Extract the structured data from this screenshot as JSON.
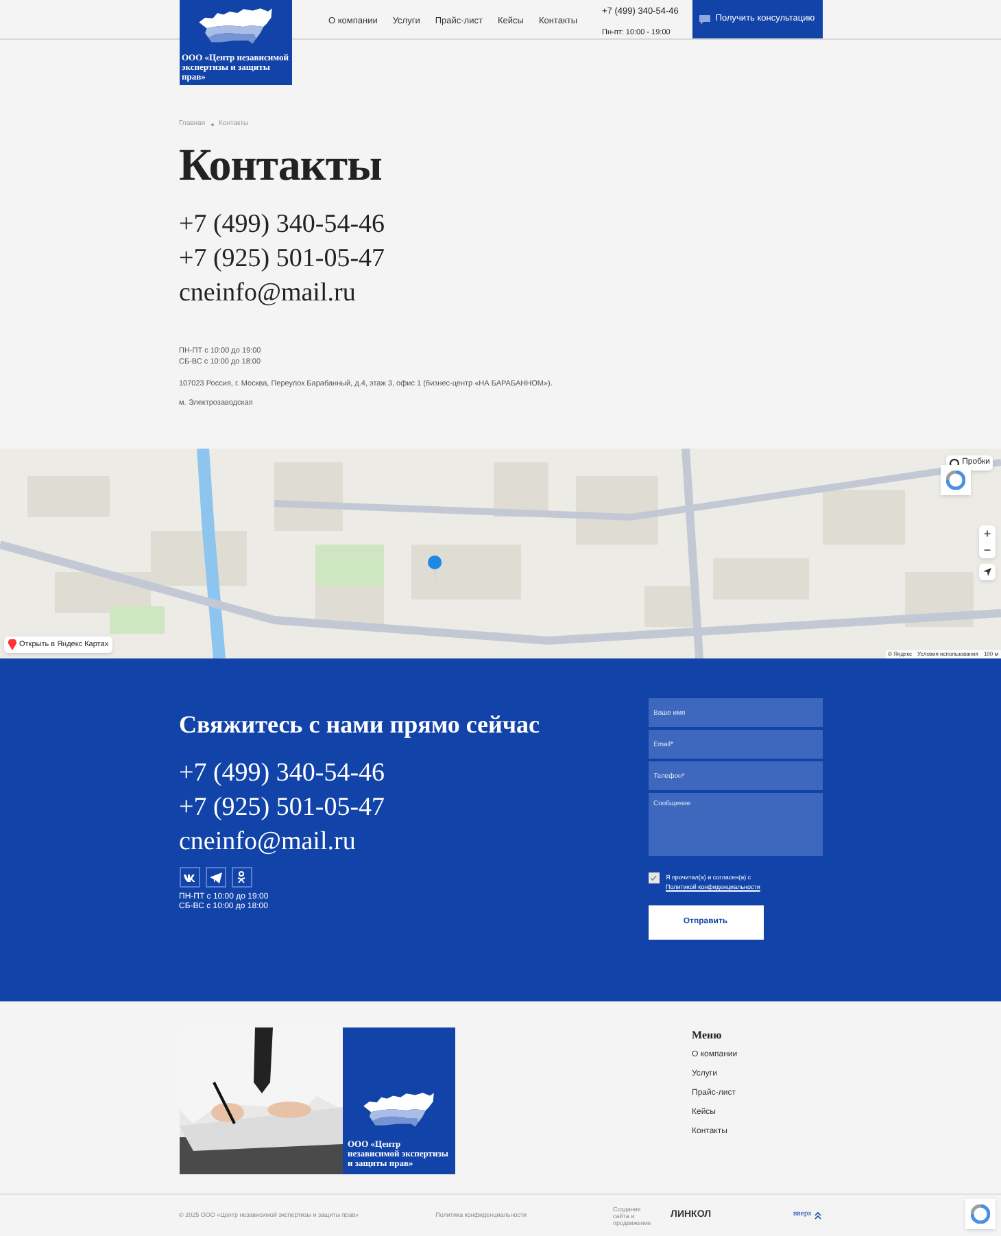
{
  "header": {
    "logo_text": "ООО «Центр независимой экспертизы и защиты прав»",
    "nav": [
      {
        "label": "О компании"
      },
      {
        "label": "Услуги"
      },
      {
        "label": "Прайс-лист"
      },
      {
        "label": "Кейсы"
      },
      {
        "label": "Контакты"
      }
    ],
    "phone": "+7 (499) 340-54-46",
    "hours": "Пн-пт: 10:00 - 19:00",
    "cta": "Получить консультацию"
  },
  "breadcrumbs": [
    "Главная",
    "Контакты"
  ],
  "title": "Контакты",
  "contacts": {
    "phones": [
      "+7 (499) 340-54-46",
      "+7 (925) 501-05-47"
    ],
    "email": "cneinfo@mail.ru",
    "hours": [
      "ПН-ПТ с 10:00 до 19:00",
      "СБ-ВС с 10:00 до 18:00"
    ],
    "address": "107023 Россия, г. Москва, Переулок Барабанный, д.4, этаж 3, офис 1 (бизнес-центр «НА БАРАБАННОМ»).",
    "metro": "м. Электрозаводская"
  },
  "map": {
    "open_button": "Открыть в Яндекс Картах",
    "traffic": "Пробки",
    "zoom_in": "+",
    "zoom_out": "−",
    "attribution": [
      "© Яндекс",
      "Условия использования",
      "100 м"
    ]
  },
  "callback": {
    "title": "Свяжитесь с нами прямо сейчас",
    "phones": [
      "+7 (499) 340-54-46",
      "+7 (925) 501-05-47"
    ],
    "email": "cneinfo@mail.ru",
    "socials": [
      {
        "kind": "vk"
      },
      {
        "kind": "telegram"
      },
      {
        "kind": "ok"
      }
    ],
    "hours": [
      "ПН-ПТ с 10:00 до 19:00",
      "СБ-ВС с 10:00 до 18:00"
    ],
    "form": {
      "fields": [
        {
          "kind": "input",
          "placeholder": "Ваше имя"
        },
        {
          "kind": "input",
          "placeholder": "Email*"
        },
        {
          "kind": "input",
          "placeholder": "Телефон*"
        },
        {
          "kind": "textarea",
          "placeholder": "Сообщение"
        }
      ],
      "consent": {
        "text": "Я прочитал(а) и согласен(а) с",
        "link": "Политикой конфиденциальности",
        "checked": true
      },
      "submit": "Отправить"
    }
  },
  "footer": {
    "logo_text": "ООО «Центр независимой экспертизы и защиты прав»",
    "menu_title": "Меню",
    "menu": [
      {
        "label": "О компании"
      },
      {
        "label": "Услуги"
      },
      {
        "label": "Прайс-лист"
      },
      {
        "label": "Кейсы"
      },
      {
        "label": "Контакты"
      }
    ],
    "copyright": "© 2025 ООО «Центр независимой экспертизы и защиты прав»",
    "privacy": "Политика конфиденциальности",
    "made_by": "Создание сайта и продвижение",
    "studio": "ЛИНКОЛ",
    "up": "вверх"
  }
}
